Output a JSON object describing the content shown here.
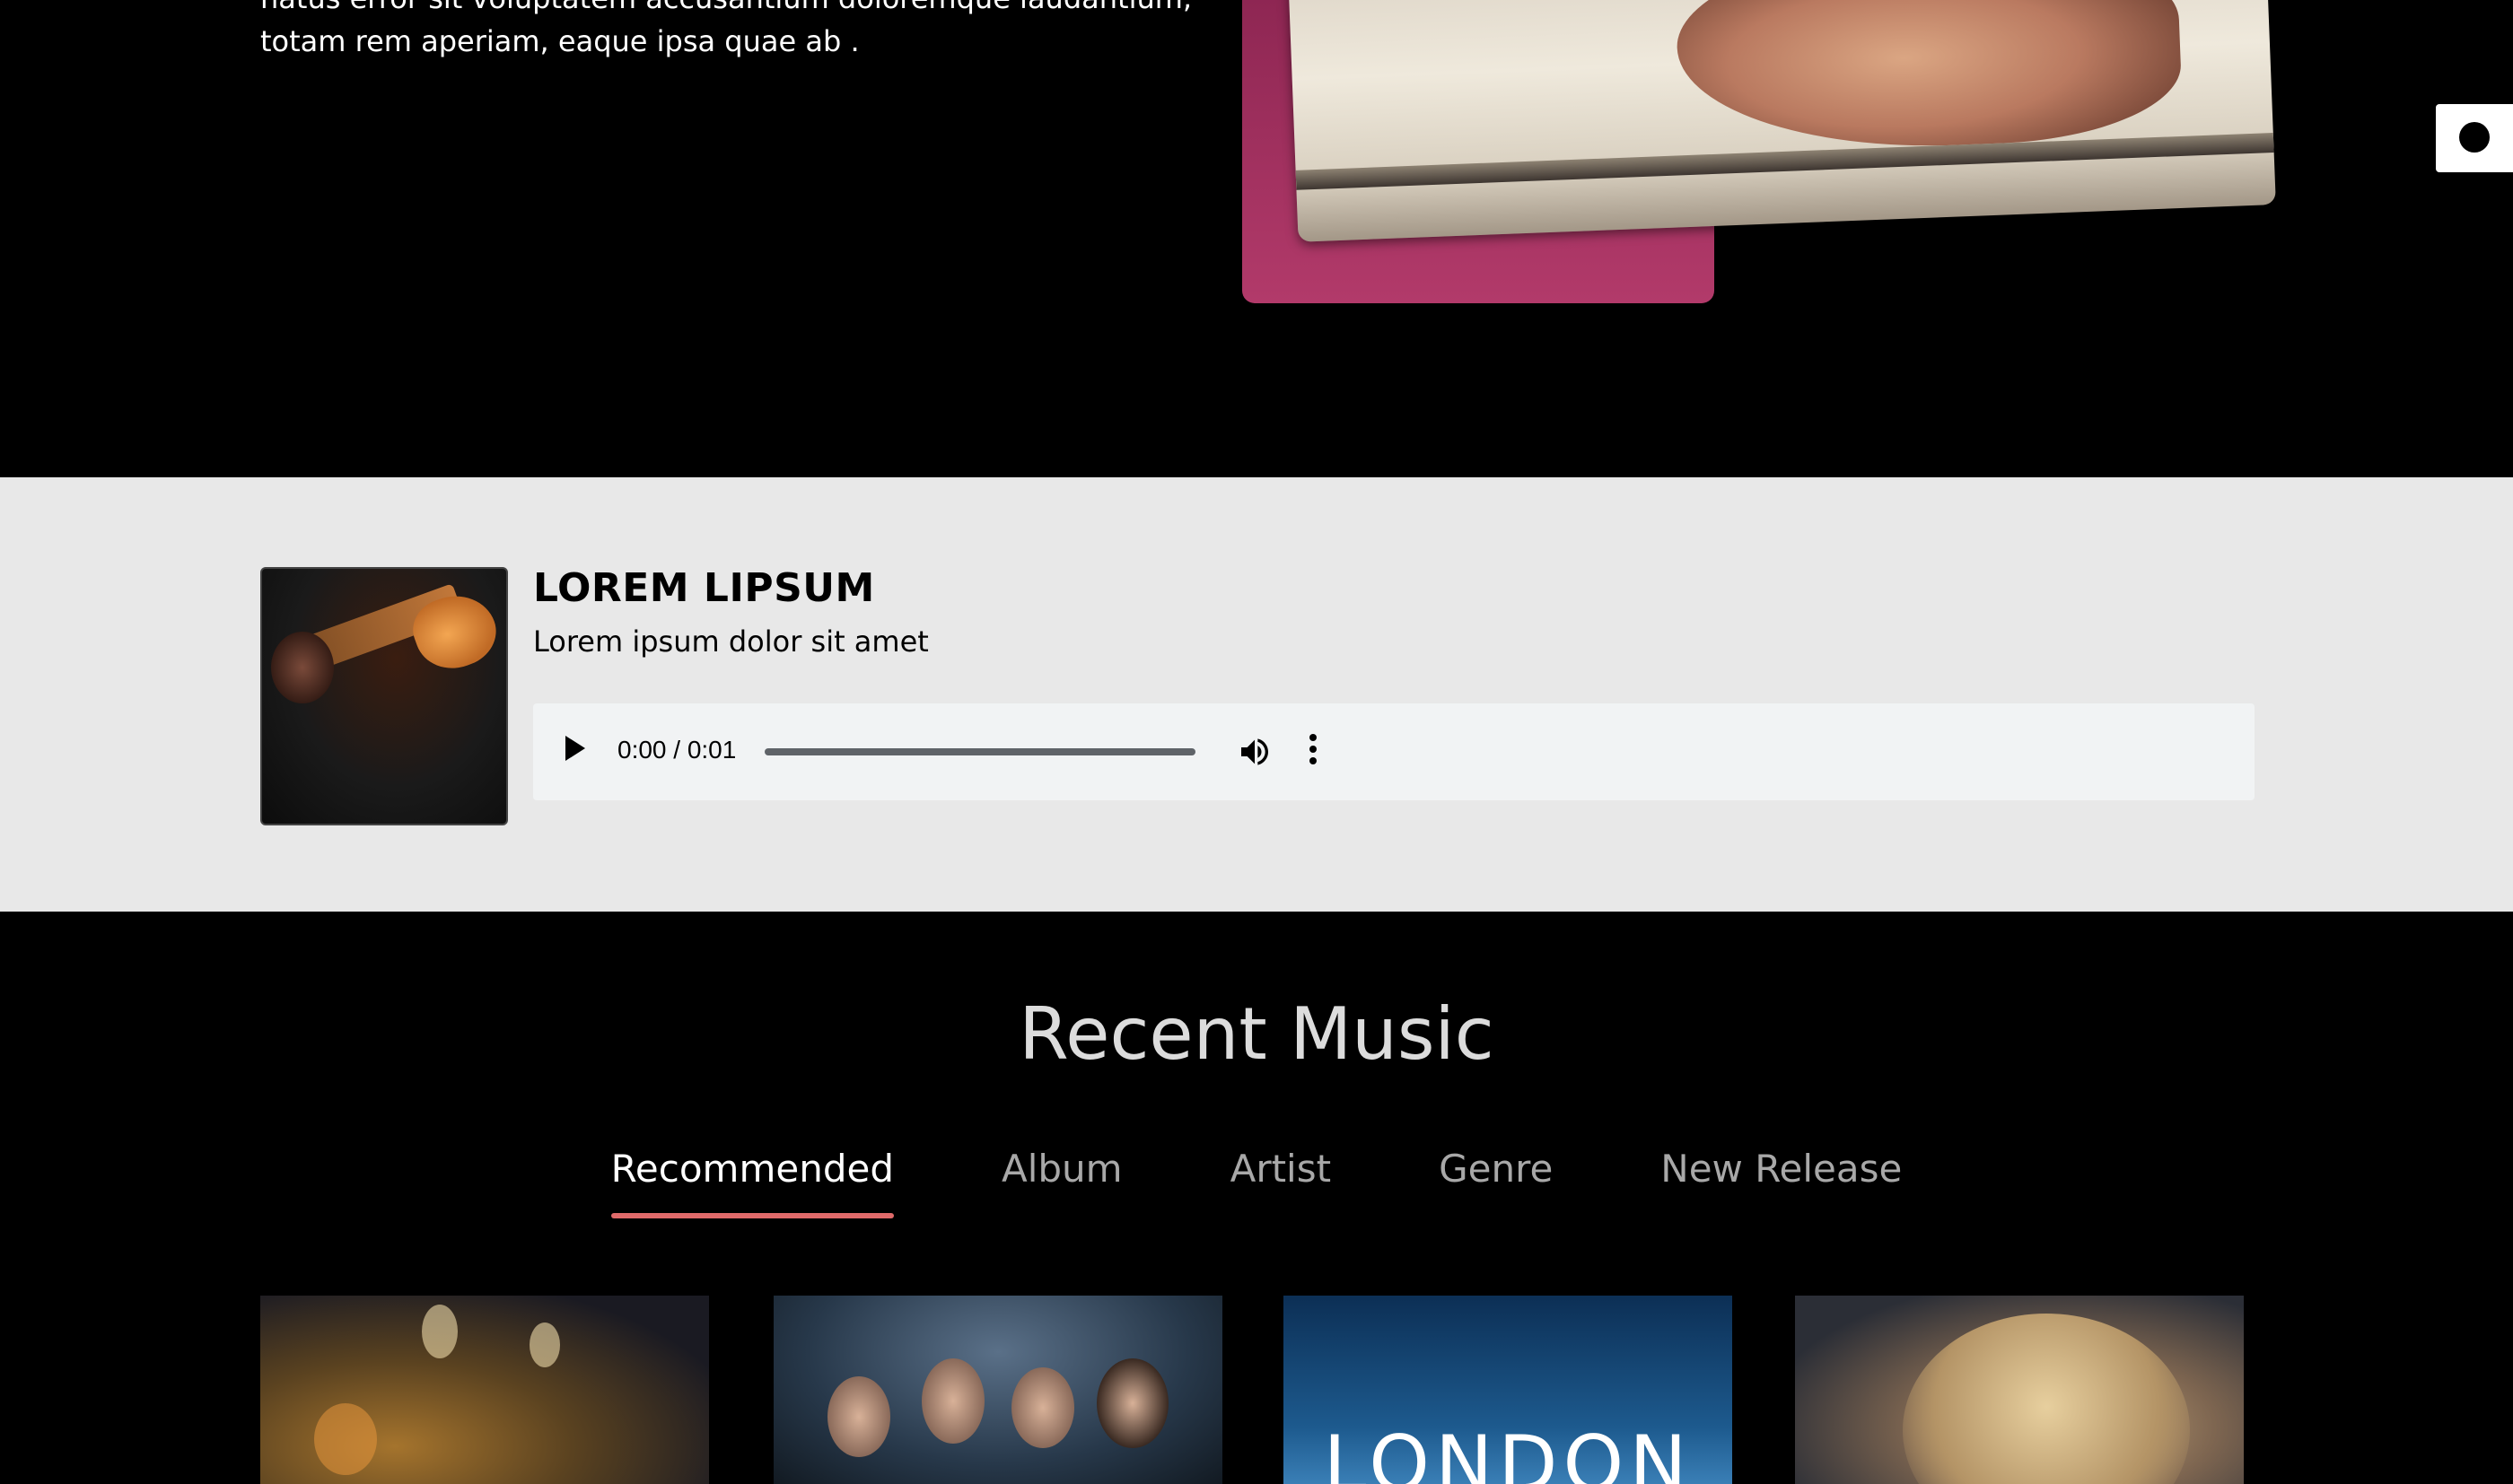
{
  "hero": {
    "text_lines": [
      "natus error sit voluptatem accusantium doloremque laudantium,",
      "totam rem aperiam, eaque ipsa quae ab ."
    ]
  },
  "player": {
    "title": "LOREM LIPSUM",
    "subtitle": "Lorem ipsum dolor sit amet",
    "time": "0:00 / 0:01",
    "progress": 0
  },
  "recent": {
    "title": "Recent Music",
    "tabs": [
      "Recommended",
      "Album",
      "Artist",
      "Genre",
      "New Release"
    ],
    "active_tab": "Recommended",
    "card3_text": "LONDON"
  },
  "colors": {
    "tab_underline": "#e06a6a",
    "frame_accent": "#b23a6a",
    "player_bg": "#e8e8e8"
  }
}
